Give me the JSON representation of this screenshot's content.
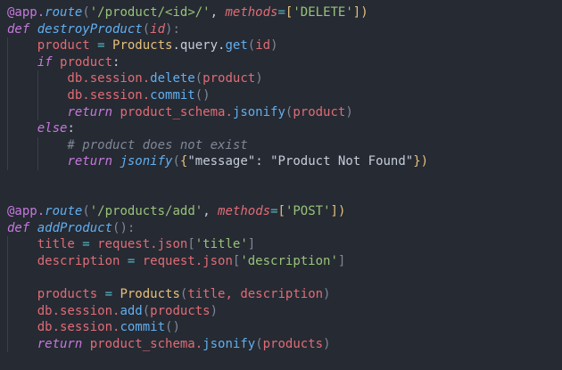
{
  "editor": {
    "language": "python",
    "colors": {
      "background": "#262a33",
      "keyword": "#c678dd",
      "function": "#61afef",
      "string": "#98c379",
      "variable": "#e06c75",
      "class": "#e5c07b",
      "comment": "#7f8796",
      "operator": "#56b6c2"
    },
    "lines": [
      {
        "indent": 0,
        "tokens": [
          {
            "t": "@app.",
            "c": "deco"
          },
          {
            "t": "route",
            "c": "fn"
          },
          {
            "t": "(",
            "c": "pn"
          },
          {
            "t": "'/product/<id>/'",
            "c": "str"
          },
          {
            "t": ", ",
            "c": "txt"
          },
          {
            "t": "methods",
            "c": "kwarg"
          },
          {
            "t": "=",
            "c": "op"
          },
          {
            "t": "[",
            "c": "br"
          },
          {
            "t": "'DELETE'",
            "c": "str"
          },
          {
            "t": "])",
            "c": "br"
          }
        ]
      },
      {
        "indent": 0,
        "tokens": [
          {
            "t": "def ",
            "c": "kw"
          },
          {
            "t": "destroyProduct",
            "c": "fn"
          },
          {
            "t": "(",
            "c": "pn"
          },
          {
            "t": "id",
            "c": "param"
          },
          {
            "t": "):",
            "c": "pn"
          }
        ]
      },
      {
        "indent": 1,
        "tokens": [
          {
            "t": "    product",
            "c": "var"
          },
          {
            "t": " = ",
            "c": "op"
          },
          {
            "t": "Products",
            "c": "cls"
          },
          {
            "t": ".query.",
            "c": "txt"
          },
          {
            "t": "get",
            "c": "meth"
          },
          {
            "t": "(",
            "c": "pn"
          },
          {
            "t": "id",
            "c": "var"
          },
          {
            "t": ")",
            "c": "pn"
          }
        ]
      },
      {
        "indent": 1,
        "tokens": [
          {
            "t": "    ",
            "c": "txt"
          },
          {
            "t": "if ",
            "c": "kw"
          },
          {
            "t": "product",
            "c": "var"
          },
          {
            "t": ":",
            "c": "txt"
          }
        ]
      },
      {
        "indent": 2,
        "tokens": [
          {
            "t": "        db.session.",
            "c": "var"
          },
          {
            "t": "delete",
            "c": "meth"
          },
          {
            "t": "(",
            "c": "pn"
          },
          {
            "t": "product",
            "c": "var"
          },
          {
            "t": ")",
            "c": "pn"
          }
        ]
      },
      {
        "indent": 2,
        "tokens": [
          {
            "t": "        db.session.",
            "c": "var"
          },
          {
            "t": "commit",
            "c": "meth"
          },
          {
            "t": "()",
            "c": "pn"
          }
        ]
      },
      {
        "indent": 2,
        "tokens": [
          {
            "t": "        ",
            "c": "txt"
          },
          {
            "t": "return ",
            "c": "kw"
          },
          {
            "t": "product_schema.",
            "c": "var"
          },
          {
            "t": "jsonify",
            "c": "meth"
          },
          {
            "t": "(",
            "c": "pn"
          },
          {
            "t": "product",
            "c": "var"
          },
          {
            "t": ")",
            "c": "pn"
          }
        ]
      },
      {
        "indent": 1,
        "tokens": [
          {
            "t": "    ",
            "c": "txt"
          },
          {
            "t": "else",
            "c": "kw"
          },
          {
            "t": ":",
            "c": "txt"
          }
        ]
      },
      {
        "indent": 2,
        "tokens": [
          {
            "t": "        # product does not exist",
            "c": "cm"
          }
        ]
      },
      {
        "indent": 2,
        "tokens": [
          {
            "t": "        ",
            "c": "txt"
          },
          {
            "t": "return ",
            "c": "kw"
          },
          {
            "t": "jsonify",
            "c": "fn"
          },
          {
            "t": "(",
            "c": "pn"
          },
          {
            "t": "{",
            "c": "br"
          },
          {
            "t": "\"message\"",
            "c": "strb"
          },
          {
            "t": ": ",
            "c": "txt"
          },
          {
            "t": "\"Product Not Found\"",
            "c": "strb"
          },
          {
            "t": "})",
            "c": "br"
          }
        ]
      },
      {
        "indent": 0,
        "tokens": []
      },
      {
        "indent": 0,
        "tokens": []
      },
      {
        "indent": 0,
        "tokens": [
          {
            "t": "@app.",
            "c": "deco"
          },
          {
            "t": "route",
            "c": "fn"
          },
          {
            "t": "(",
            "c": "pn"
          },
          {
            "t": "'/products/add'",
            "c": "str"
          },
          {
            "t": ", ",
            "c": "txt"
          },
          {
            "t": "methods",
            "c": "kwarg"
          },
          {
            "t": "=",
            "c": "op"
          },
          {
            "t": "[",
            "c": "br"
          },
          {
            "t": "'POST'",
            "c": "str"
          },
          {
            "t": "])",
            "c": "br"
          }
        ]
      },
      {
        "indent": 0,
        "tokens": [
          {
            "t": "def ",
            "c": "kw"
          },
          {
            "t": "addProduct",
            "c": "fn"
          },
          {
            "t": "():",
            "c": "pn"
          }
        ]
      },
      {
        "indent": 1,
        "tokens": [
          {
            "t": "    title",
            "c": "var"
          },
          {
            "t": " = ",
            "c": "op"
          },
          {
            "t": "request.json",
            "c": "var"
          },
          {
            "t": "[",
            "c": "pn"
          },
          {
            "t": "'title'",
            "c": "str"
          },
          {
            "t": "]",
            "c": "pn"
          }
        ]
      },
      {
        "indent": 1,
        "tokens": [
          {
            "t": "    description",
            "c": "var"
          },
          {
            "t": " = ",
            "c": "op"
          },
          {
            "t": "request.json",
            "c": "var"
          },
          {
            "t": "[",
            "c": "pn"
          },
          {
            "t": "'description'",
            "c": "str"
          },
          {
            "t": "]",
            "c": "pn"
          }
        ]
      },
      {
        "indent": 1,
        "tokens": []
      },
      {
        "indent": 1,
        "tokens": [
          {
            "t": "    products",
            "c": "var"
          },
          {
            "t": " = ",
            "c": "op"
          },
          {
            "t": "Products",
            "c": "cls"
          },
          {
            "t": "(",
            "c": "pn"
          },
          {
            "t": "title, description",
            "c": "var"
          },
          {
            "t": ")",
            "c": "pn"
          }
        ]
      },
      {
        "indent": 1,
        "tokens": [
          {
            "t": "    db.session.",
            "c": "var"
          },
          {
            "t": "add",
            "c": "meth"
          },
          {
            "t": "(",
            "c": "pn"
          },
          {
            "t": "products",
            "c": "var"
          },
          {
            "t": ")",
            "c": "pn"
          }
        ]
      },
      {
        "indent": 1,
        "tokens": [
          {
            "t": "    db.session.",
            "c": "var"
          },
          {
            "t": "commit",
            "c": "meth"
          },
          {
            "t": "()",
            "c": "pn"
          }
        ]
      },
      {
        "indent": 1,
        "tokens": [
          {
            "t": "    ",
            "c": "txt"
          },
          {
            "t": "return ",
            "c": "kw"
          },
          {
            "t": "product_schema.",
            "c": "var"
          },
          {
            "t": "jsonify",
            "c": "meth"
          },
          {
            "t": "(",
            "c": "pn"
          },
          {
            "t": "products",
            "c": "var"
          },
          {
            "t": ")",
            "c": "pn"
          }
        ]
      }
    ]
  }
}
